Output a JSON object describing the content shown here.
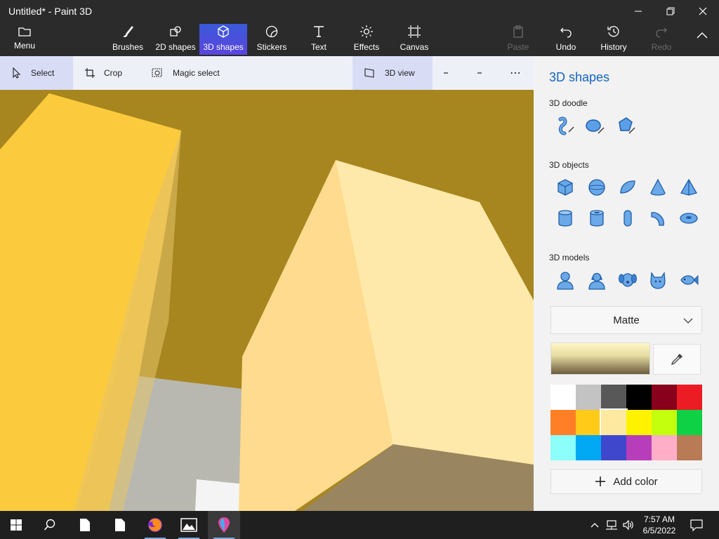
{
  "window": {
    "title": "Untitled* - Paint 3D",
    "minimize_icon": "minimize-icon",
    "maximize_icon": "restore-icon",
    "close_icon": "close-icon"
  },
  "ribbon": {
    "menu_label": "Menu",
    "tools": [
      {
        "label": "Brushes",
        "icon": "brush-icon"
      },
      {
        "label": "2D shapes",
        "icon": "2d-shapes-icon"
      },
      {
        "label": "3D shapes",
        "icon": "cube-icon",
        "active": true
      },
      {
        "label": "Stickers",
        "icon": "sticker-icon"
      },
      {
        "label": "Text",
        "icon": "text-icon"
      },
      {
        "label": "Effects",
        "icon": "effects-icon"
      },
      {
        "label": "Canvas",
        "icon": "canvas-icon"
      }
    ],
    "actions": [
      {
        "label": "Paste",
        "icon": "paste-icon",
        "disabled": true
      },
      {
        "label": "Undo",
        "icon": "undo-icon"
      },
      {
        "label": "History",
        "icon": "history-icon"
      },
      {
        "label": "Redo",
        "icon": "redo-icon",
        "disabled": true
      }
    ]
  },
  "toolbar": {
    "select_label": "Select",
    "crop_label": "Crop",
    "magic_select_label": "Magic select",
    "view_3d_label": "3D view",
    "more_label": "⋯"
  },
  "panel": {
    "title": "3D shapes",
    "doodle_label": "3D doodle",
    "objects_label": "3D objects",
    "models_label": "3D models",
    "material": "Matte",
    "add_color_label": "Add color",
    "selected_color": "#fde9a0",
    "palette": [
      "#ffffff",
      "#c3c3c3",
      "#585858",
      "#000000",
      "#88001b",
      "#ec1c24",
      "#ff7f27",
      "#ffca18",
      "#fde9a0",
      "#fff200",
      "#c4ff0e",
      "#0ed145",
      "#8cfffb",
      "#00a8f3",
      "#3f48cc",
      "#b83dba",
      "#ffaec8",
      "#b97a56"
    ]
  },
  "taskbar": {
    "time": "7:57 AM",
    "date": "6/5/2022"
  }
}
